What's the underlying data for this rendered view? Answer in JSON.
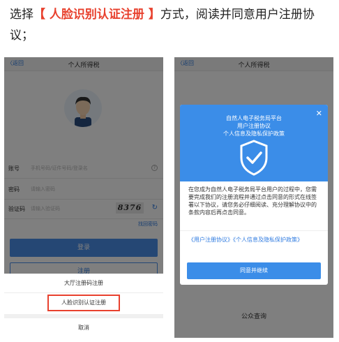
{
  "instruction": {
    "prefix": "选择",
    "highlight": "【 人脸识别认证注册 】",
    "suffix": "方式，阅读并同意用户注册协议；"
  },
  "left_phone": {
    "nav": {
      "back_label": "〈返回",
      "title": "个人所得税"
    },
    "form": {
      "account_label": "账号",
      "account_placeholder": "手机号码/证件号码/登录名",
      "password_label": "密码",
      "password_placeholder": "请输入密码",
      "captcha_label": "验证码",
      "captcha_placeholder": "请输入验证码",
      "captcha_image_text": "8376"
    },
    "forgot_label": "找回密码",
    "login_label": "登录",
    "register_label": "注册",
    "sheet": {
      "hall_code_label": "大厅注册码注册",
      "face_label": "人脸识别认证注册",
      "cancel_label": "取消"
    }
  },
  "right_phone": {
    "nav": {
      "back_label": "〈返回",
      "title": "个人所得税"
    },
    "public_query_label": "公众查询",
    "modal": {
      "head_lines": [
        "自然人电子税务局平台",
        "用户注册协议",
        "个人信息及隐私保护政策"
      ],
      "close_icon": "close-icon",
      "shield_icon": "shield-check-icon",
      "body_text": "在您成为自然人电子税务局平台用户的过程中，您需要完成我们的注册流程并通过点击同意的形式在线签署以下协议，请您务必仔细阅读、充分理解协议中的条款内容后再点击同意。",
      "links_text": "《用户注册协议》《个人信息及隐私保护政策》",
      "agree_label": "同意并继续"
    }
  },
  "colors": {
    "accent": "#3b8de8",
    "highlight": "#e8412e"
  }
}
